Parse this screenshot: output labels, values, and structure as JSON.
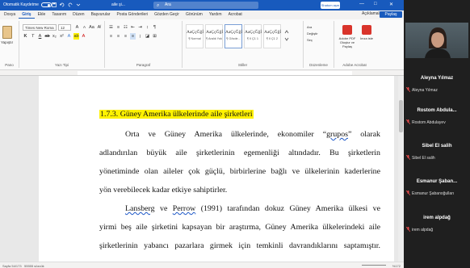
{
  "titlebar": {
    "autosave_label": "Otomatik Kaydetme",
    "doc_title": "aile şi...",
    "search_placeholder": "Ara",
    "user_button": "Shatum aşm",
    "min": "—",
    "max": "□",
    "close": "✕"
  },
  "menu": {
    "tabs": [
      "Dosya",
      "Giriş",
      "Ekle",
      "Tasarım",
      "Düzen",
      "Başvurular",
      "Posta Gönderileri",
      "Gözden Geçir",
      "Görünüm",
      "Yardım",
      "Acrobat"
    ],
    "comments": "Açıklamalar",
    "share": "Paylaş"
  },
  "ribbon": {
    "paste": "Yapıştır",
    "clipboard_group": "Pano",
    "font_name": "Times New Roma",
    "font_size": "12",
    "font_group": "Yazı Tipi",
    "paragraph_group": "Paragraf",
    "styles": [
      {
        "sample": "AaÇçĞğİ",
        "name": "¶ Normal"
      },
      {
        "sample": "AaÇçĞğİ",
        "name": "¶ Aralık Yok"
      },
      {
        "sample": "AaÇçĞğİ",
        "name": "¶ Gövde..."
      },
      {
        "sample": "AaÇçĞğİ",
        "name": "¶ Il Ç1 1"
      },
      {
        "sample": "AaÇçĞğİ",
        "name": "¶ Il Ç1 2"
      }
    ],
    "styles_group": "Stiller",
    "editing": {
      "find": "Ara",
      "replace": "Değiştir",
      "select": "Seç"
    },
    "editing_group": "Düzenleme",
    "adobe_create": "Adobe PDF Oluştur ve Paylaş",
    "adobe_share": "İmza iste",
    "adobe_group": "Adobe Acrobat"
  },
  "document": {
    "heading": "1.7.3. Güney Amerika ülkelerinde aile şirketleri",
    "lines": [
      {
        "segments": [
          {
            "t": "Orta ve Güney Amerika ülkelerinde, ekonomiler “"
          },
          {
            "t": "grupos",
            "squig": true
          },
          {
            "t": "” olarak"
          }
        ],
        "justify": true,
        "indent": true
      },
      {
        "segments": [
          {
            "t": "adlandırılan büyük aile şirketlerinin egemenliği altındadır. Bu şirketlerin"
          }
        ],
        "justify": true
      },
      {
        "segments": [
          {
            "t": "yönetiminde olan aileler çok güçlü, birbirlerine bağlı ve ülkelerinin kaderlerine"
          }
        ],
        "justify": true
      },
      {
        "segments": [
          {
            "t": "yön verebilecek kadar etkiye sahiptirler."
          }
        ],
        "justify": false
      },
      {
        "segments": [
          {
            "t": "Lansberg",
            "squig": true
          },
          {
            "t": " ve "
          },
          {
            "t": "Perrow",
            "squig": true
          },
          {
            "t": " (1991) tarafından dokuz Güney Amerika ülkesi ve"
          }
        ],
        "justify": true,
        "indent": true
      },
      {
        "segments": [
          {
            "t": "yirmi beş aile şirketini kapsayan bir araştırma, Güney Amerika ülkelerindeki aile"
          }
        ],
        "justify": true
      },
      {
        "segments": [
          {
            "t": "şirketlerinin yabancı pazarlara girmek için temkinli davrandıklarını saptamıştır."
          }
        ],
        "justify": true
      }
    ]
  },
  "statusbar": {
    "page": "Sayfa 54/173",
    "words": "55555 sözcük",
    "zoom": "%172"
  },
  "participants": [
    {
      "name": "Aleyna Yılmaz",
      "sub": "Aleyna Yılmaz"
    },
    {
      "name": "Rostom Abdula...",
      "sub": "Rostom Abdulayev"
    },
    {
      "name": "Sibel El salih",
      "sub": "Sibel El salih"
    },
    {
      "name": "Esmanur Şaban...",
      "sub": "Esmanur Şabanoğulları"
    },
    {
      "name": "irem alpdağ",
      "sub": "irem alpdağ"
    }
  ],
  "colors": {
    "word_blue": "#185abd",
    "highlight": "#fff200",
    "mic_muted": "#e34a4a"
  }
}
